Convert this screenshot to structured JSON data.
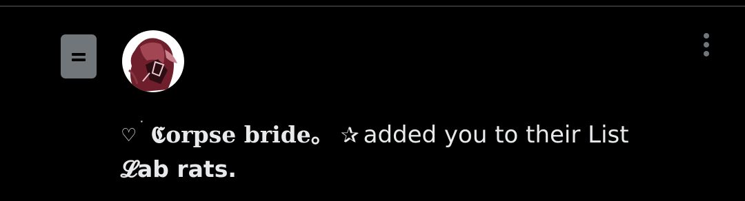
{
  "notification": {
    "icon": "list-icon",
    "avatar_icon": "user-avatar",
    "more_icon": "more-vertical-icon",
    "heart_glyph": "♡",
    "sup_dot": "˙",
    "user_name": "𝕮orpse bride。",
    "star_glyph": "✰",
    "action_text": "added you to their List",
    "list_name": "𝓛ab rats."
  },
  "colors": {
    "background": "#000000",
    "divider": "#2f3336",
    "text_primary": "#e7e9ea",
    "icon_gray": "#71767b"
  }
}
